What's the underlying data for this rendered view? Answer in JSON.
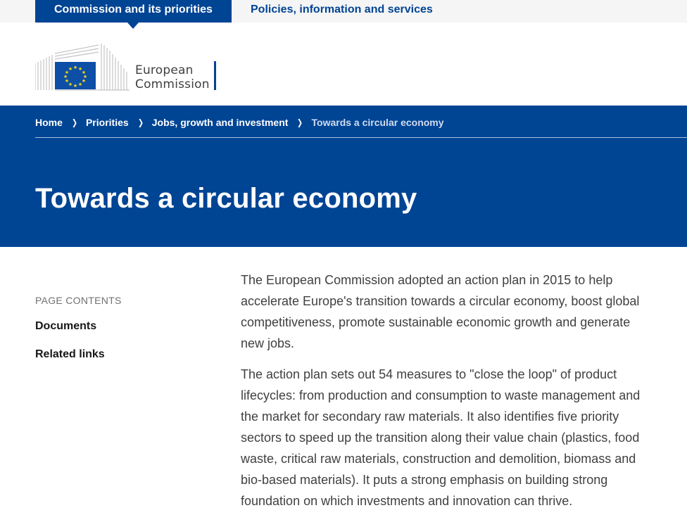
{
  "topbar": {
    "active_tab": "Commission and its priorities",
    "other_tab": "Policies, information and services"
  },
  "logo": {
    "line1": "European",
    "line2": "Commission"
  },
  "breadcrumb": {
    "items": [
      "Home",
      "Priorities",
      "Jobs, growth and investment",
      "Towards a circular economy"
    ]
  },
  "page": {
    "title": "Towards a circular economy"
  },
  "sidebar": {
    "heading": "PAGE CONTENTS",
    "links": [
      "Documents",
      "Related links"
    ]
  },
  "article": {
    "paragraphs": [
      "The European Commission adopted an action plan in 2015 to help accelerate Europe's transition towards a circular economy, boost global competitiveness, promote sustainable economic growth and generate new jobs.",
      "The action plan sets out 54 measures to \"close the loop\" of product lifecycles: from production and consumption to waste management and the market for secondary raw materials. It also identifies five priority sectors to speed up the transition along their value chain (plastics, food waste, critical raw materials, construction and demolition, biomass and bio-based materials).  It puts a strong emphasis on building strong foundation on which investments and innovation can thrive."
    ]
  },
  "colors": {
    "brand_blue": "#004494",
    "topbar_bg": "#f5f5f5",
    "eu_yellow": "#ffdd00"
  }
}
